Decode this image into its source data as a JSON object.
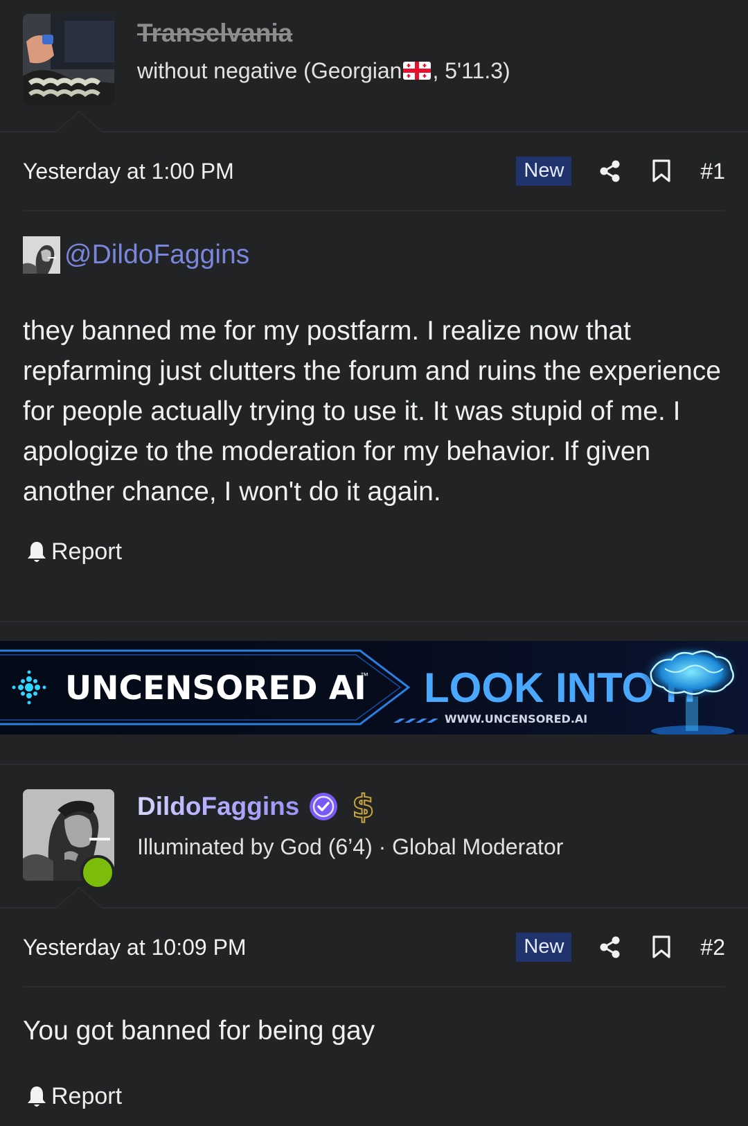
{
  "post1": {
    "username": "Transelvania",
    "user_title_prefix": "without negative (Georgian",
    "user_title_suffix": ", 5'11.3)",
    "date": "Yesterday at 1:00 PM",
    "new_badge": "New",
    "post_number": "#1",
    "mention": "@DildoFaggins",
    "body": "they banned me for my postfarm. I realize now that repfarming just clutters the forum and ruins the experience for people actually trying to use it. It was stupid of me. I apologize to the moderation for my behavior. If given another chance, I won't do it again.",
    "report_label": "Report"
  },
  "ad": {
    "brand": "UNCENSORED AI",
    "tm": "™",
    "cta": "LOOK INTO IT",
    "url": "WWW.UNCENSORED.AI"
  },
  "post2": {
    "username": "DildoFaggins",
    "dollar_symbol": "$",
    "user_title": "Illuminated by God (6’4) · Global Moderator",
    "date": "Yesterday at 10:09 PM",
    "new_badge": "New",
    "post_number": "#2",
    "body": "You got banned for being gay",
    "report_label": "Report"
  },
  "icons": {
    "share": "share-icon",
    "bookmark": "bookmark-icon",
    "report": "bell-icon",
    "verified": "verified-check-icon",
    "flag": "georgia-flag-icon"
  },
  "colors": {
    "background": "#222325",
    "new_badge_bg": "#20336c",
    "mention": "#7a86dc",
    "online": "#7bbd0a",
    "verified": "#7a5af5"
  }
}
